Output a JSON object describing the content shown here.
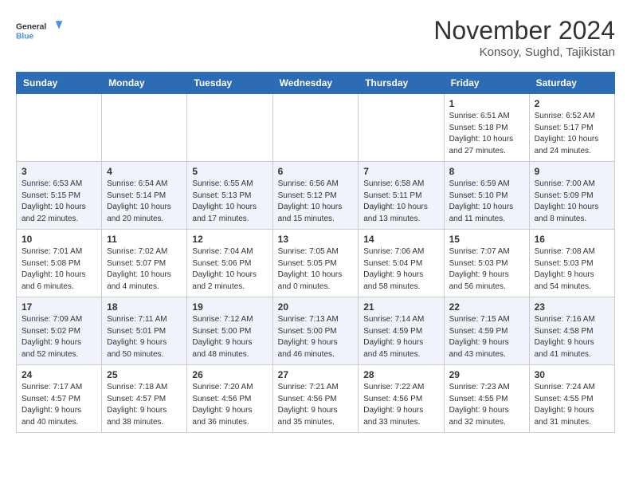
{
  "header": {
    "logo_line1": "General",
    "logo_line2": "Blue",
    "month": "November 2024",
    "location": "Konsoy, Sughd, Tajikistan"
  },
  "days_of_week": [
    "Sunday",
    "Monday",
    "Tuesday",
    "Wednesday",
    "Thursday",
    "Friday",
    "Saturday"
  ],
  "weeks": [
    [
      {
        "day": "",
        "info": ""
      },
      {
        "day": "",
        "info": ""
      },
      {
        "day": "",
        "info": ""
      },
      {
        "day": "",
        "info": ""
      },
      {
        "day": "",
        "info": ""
      },
      {
        "day": "1",
        "info": "Sunrise: 6:51 AM\nSunset: 5:18 PM\nDaylight: 10 hours\nand 27 minutes."
      },
      {
        "day": "2",
        "info": "Sunrise: 6:52 AM\nSunset: 5:17 PM\nDaylight: 10 hours\nand 24 minutes."
      }
    ],
    [
      {
        "day": "3",
        "info": "Sunrise: 6:53 AM\nSunset: 5:15 PM\nDaylight: 10 hours\nand 22 minutes."
      },
      {
        "day": "4",
        "info": "Sunrise: 6:54 AM\nSunset: 5:14 PM\nDaylight: 10 hours\nand 20 minutes."
      },
      {
        "day": "5",
        "info": "Sunrise: 6:55 AM\nSunset: 5:13 PM\nDaylight: 10 hours\nand 17 minutes."
      },
      {
        "day": "6",
        "info": "Sunrise: 6:56 AM\nSunset: 5:12 PM\nDaylight: 10 hours\nand 15 minutes."
      },
      {
        "day": "7",
        "info": "Sunrise: 6:58 AM\nSunset: 5:11 PM\nDaylight: 10 hours\nand 13 minutes."
      },
      {
        "day": "8",
        "info": "Sunrise: 6:59 AM\nSunset: 5:10 PM\nDaylight: 10 hours\nand 11 minutes."
      },
      {
        "day": "9",
        "info": "Sunrise: 7:00 AM\nSunset: 5:09 PM\nDaylight: 10 hours\nand 8 minutes."
      }
    ],
    [
      {
        "day": "10",
        "info": "Sunrise: 7:01 AM\nSunset: 5:08 PM\nDaylight: 10 hours\nand 6 minutes."
      },
      {
        "day": "11",
        "info": "Sunrise: 7:02 AM\nSunset: 5:07 PM\nDaylight: 10 hours\nand 4 minutes."
      },
      {
        "day": "12",
        "info": "Sunrise: 7:04 AM\nSunset: 5:06 PM\nDaylight: 10 hours\nand 2 minutes."
      },
      {
        "day": "13",
        "info": "Sunrise: 7:05 AM\nSunset: 5:05 PM\nDaylight: 10 hours\nand 0 minutes."
      },
      {
        "day": "14",
        "info": "Sunrise: 7:06 AM\nSunset: 5:04 PM\nDaylight: 9 hours\nand 58 minutes."
      },
      {
        "day": "15",
        "info": "Sunrise: 7:07 AM\nSunset: 5:03 PM\nDaylight: 9 hours\nand 56 minutes."
      },
      {
        "day": "16",
        "info": "Sunrise: 7:08 AM\nSunset: 5:03 PM\nDaylight: 9 hours\nand 54 minutes."
      }
    ],
    [
      {
        "day": "17",
        "info": "Sunrise: 7:09 AM\nSunset: 5:02 PM\nDaylight: 9 hours\nand 52 minutes."
      },
      {
        "day": "18",
        "info": "Sunrise: 7:11 AM\nSunset: 5:01 PM\nDaylight: 9 hours\nand 50 minutes."
      },
      {
        "day": "19",
        "info": "Sunrise: 7:12 AM\nSunset: 5:00 PM\nDaylight: 9 hours\nand 48 minutes."
      },
      {
        "day": "20",
        "info": "Sunrise: 7:13 AM\nSunset: 5:00 PM\nDaylight: 9 hours\nand 46 minutes."
      },
      {
        "day": "21",
        "info": "Sunrise: 7:14 AM\nSunset: 4:59 PM\nDaylight: 9 hours\nand 45 minutes."
      },
      {
        "day": "22",
        "info": "Sunrise: 7:15 AM\nSunset: 4:59 PM\nDaylight: 9 hours\nand 43 minutes."
      },
      {
        "day": "23",
        "info": "Sunrise: 7:16 AM\nSunset: 4:58 PM\nDaylight: 9 hours\nand 41 minutes."
      }
    ],
    [
      {
        "day": "24",
        "info": "Sunrise: 7:17 AM\nSunset: 4:57 PM\nDaylight: 9 hours\nand 40 minutes."
      },
      {
        "day": "25",
        "info": "Sunrise: 7:18 AM\nSunset: 4:57 PM\nDaylight: 9 hours\nand 38 minutes."
      },
      {
        "day": "26",
        "info": "Sunrise: 7:20 AM\nSunset: 4:56 PM\nDaylight: 9 hours\nand 36 minutes."
      },
      {
        "day": "27",
        "info": "Sunrise: 7:21 AM\nSunset: 4:56 PM\nDaylight: 9 hours\nand 35 minutes."
      },
      {
        "day": "28",
        "info": "Sunrise: 7:22 AM\nSunset: 4:56 PM\nDaylight: 9 hours\nand 33 minutes."
      },
      {
        "day": "29",
        "info": "Sunrise: 7:23 AM\nSunset: 4:55 PM\nDaylight: 9 hours\nand 32 minutes."
      },
      {
        "day": "30",
        "info": "Sunrise: 7:24 AM\nSunset: 4:55 PM\nDaylight: 9 hours\nand 31 minutes."
      }
    ]
  ]
}
